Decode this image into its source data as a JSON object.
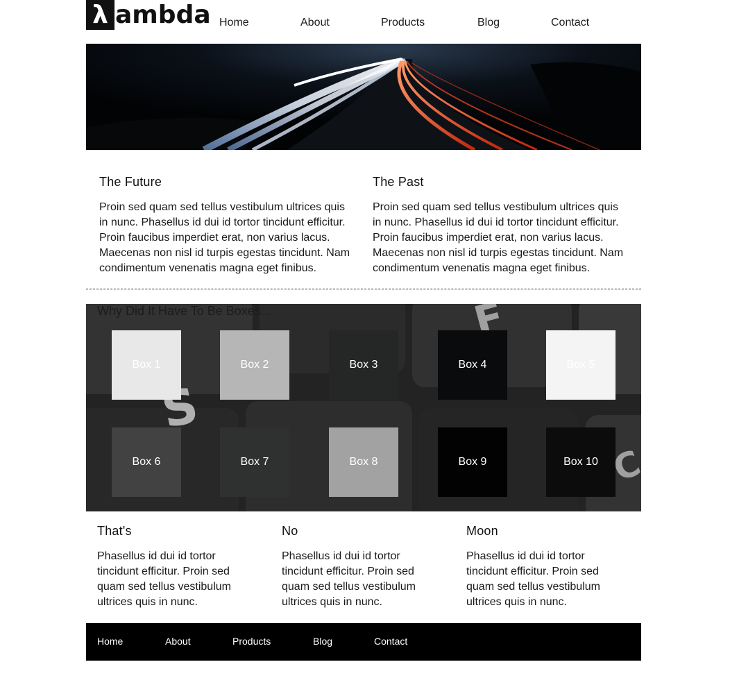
{
  "brand": {
    "mark": "λ",
    "text": "ambda"
  },
  "nav": [
    "Home",
    "About",
    "Products",
    "Blog",
    "Contact"
  ],
  "hero": {
    "image": "highway-light-trails-at-night"
  },
  "sections": [
    {
      "title": "The Future",
      "body": "Proin sed quam sed tellus vestibulum ultrices quis in nunc. Phasellus id dui id tortor tincidunt efficitur. Proin faucibus imperdiet erat, non varius lacus. Maecenas non nisl id turpis egestas tincidunt. Nam condimentum venenatis magna eget finibus."
    },
    {
      "title": "The Past",
      "body": "Proin sed quam sed tellus vestibulum ultrices quis in nunc. Phasellus id dui id tortor tincidunt efficitur. Proin faucibus imperdiet erat, non varius lacus. Maecenas non nisl id turpis egestas tincidunt. Nam condimentum venenatis magna eget finibus."
    }
  ],
  "boxes_section": {
    "title": "Why Did It Have To Be Boxes...",
    "background_image": "keyboard-keys-closeup",
    "boxes": [
      {
        "label": "Box 1",
        "color": "#e8e8e8"
      },
      {
        "label": "Box 2",
        "color": "#b6b6b6"
      },
      {
        "label": "Box 3",
        "color": "#252727"
      },
      {
        "label": "Box 4",
        "color": "#0a0b0c"
      },
      {
        "label": "Box 5",
        "color": "#f4f4f4"
      },
      {
        "label": "Box 6",
        "color": "#424242"
      },
      {
        "label": "Box 7",
        "color": "#2f3131"
      },
      {
        "label": "Box 8",
        "color": "#a2a2a2"
      },
      {
        "label": "Box 9",
        "color": "#020202"
      },
      {
        "label": "Box 10",
        "color": "#0c0c0c"
      }
    ]
  },
  "features": [
    {
      "title": "That's",
      "body": "Phasellus id dui id tortor tincidunt efficitur. Proin sed quam sed tellus vestibulum ultrices quis in nunc."
    },
    {
      "title": "No",
      "body": "Phasellus id dui id tortor tincidunt efficitur. Proin sed quam sed tellus vestibulum ultrices quis in nunc."
    },
    {
      "title": "Moon",
      "body": "Phasellus id dui id tortor tincidunt efficitur. Proin sed quam sed tellus vestibulum ultrices quis in nunc."
    }
  ],
  "footer_nav": [
    "Home",
    "About",
    "Products",
    "Blog",
    "Contact"
  ]
}
